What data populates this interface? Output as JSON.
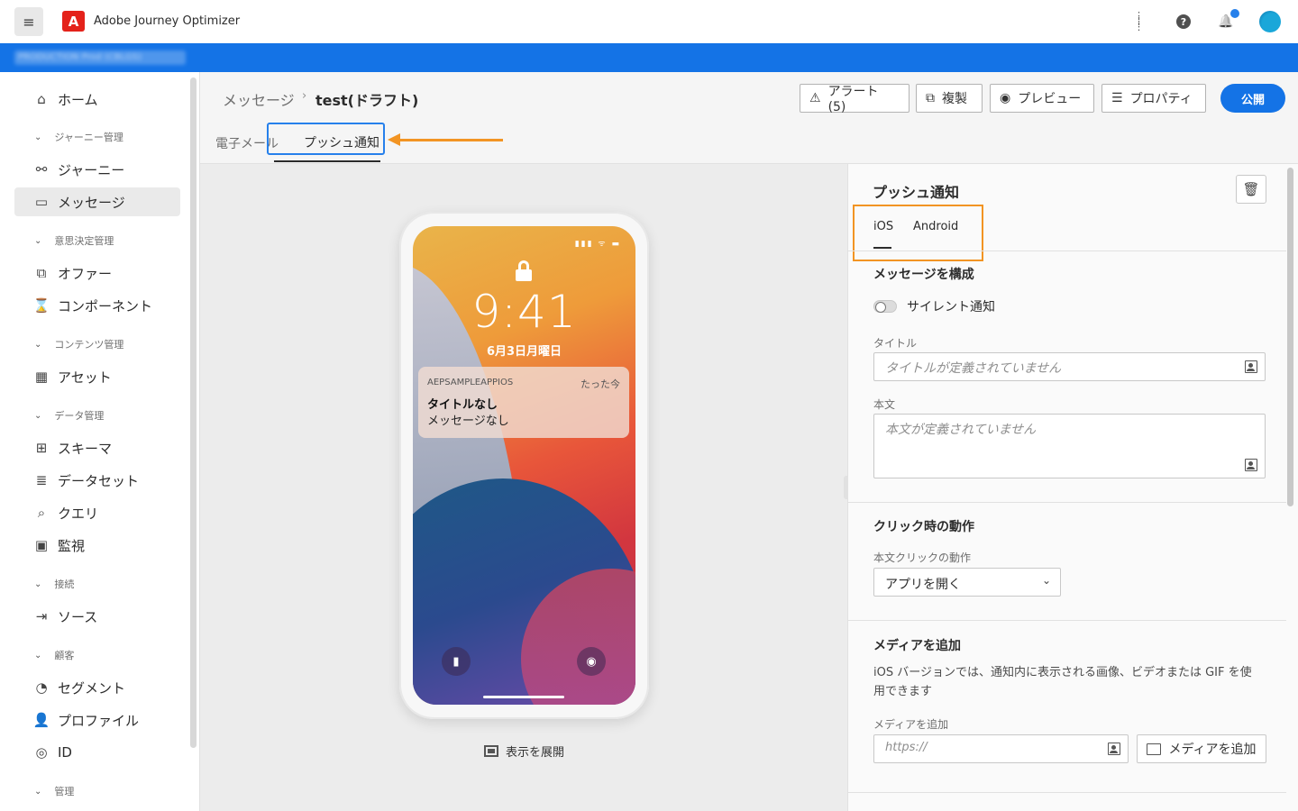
{
  "app": {
    "title": "Adobe Journey Optimizer",
    "logo_letter": "A",
    "org_switcher": "PRODUCTION  Prod (CBLGS)",
    "colors": {
      "accent": "#1473e6",
      "highlight": "#f29423",
      "focus": "#2680eb"
    }
  },
  "topbar": {
    "menu_icon": "hamburger-icon",
    "icons": [
      "apps-grid-icon",
      "help-icon",
      "bell-icon"
    ],
    "glyphs": {
      "menu": "≡",
      "apps": "⋮⋮⋮",
      "help": "?",
      "bell": "🔔"
    }
  },
  "sidebar": {
    "items": [
      {
        "type": "item",
        "label": "ホーム",
        "icon": "⌂",
        "active": false
      },
      {
        "type": "section",
        "label": "ジャーニー管理"
      },
      {
        "type": "item",
        "label": "ジャーニー",
        "icon": "⚯",
        "active": false
      },
      {
        "type": "item",
        "label": "メッセージ",
        "icon": "▭",
        "active": true
      },
      {
        "type": "section",
        "label": "意思決定管理"
      },
      {
        "type": "item",
        "label": "オファー",
        "icon": "⧉",
        "active": false
      },
      {
        "type": "item",
        "label": "コンポーネント",
        "icon": "⌛",
        "active": false
      },
      {
        "type": "section",
        "label": "コンテンツ管理"
      },
      {
        "type": "item",
        "label": "アセット",
        "icon": "▦",
        "active": false
      },
      {
        "type": "section",
        "label": "データ管理"
      },
      {
        "type": "item",
        "label": "スキーマ",
        "icon": "⊞",
        "active": false
      },
      {
        "type": "item",
        "label": "データセット",
        "icon": "≣",
        "active": false
      },
      {
        "type": "item",
        "label": "クエリ",
        "icon": "⌕",
        "active": false
      },
      {
        "type": "item",
        "label": "監視",
        "icon": "▣",
        "active": false
      },
      {
        "type": "section",
        "label": "接続"
      },
      {
        "type": "item",
        "label": "ソース",
        "icon": "⇥",
        "active": false
      },
      {
        "type": "section",
        "label": "顧客"
      },
      {
        "type": "item",
        "label": "セグメント",
        "icon": "◔",
        "active": false
      },
      {
        "type": "item",
        "label": "プロファイル",
        "icon": "👤",
        "active": false
      },
      {
        "type": "item",
        "label": "ID",
        "icon": "◎",
        "active": false
      },
      {
        "type": "section",
        "label": "管理"
      }
    ],
    "section_chevron": "⌄"
  },
  "header": {
    "breadcrumb_parent": "メッセージ",
    "breadcrumb_sep": "›",
    "breadcrumb_current": "test(ドラフト)",
    "buttons": {
      "alerts": "アラート (5)",
      "alerts_icon": "⚠",
      "duplicate": "複製",
      "duplicate_icon": "⧉",
      "preview": "プレビュー",
      "preview_icon": "◉",
      "properties": "プロパティ",
      "properties_icon": "☰",
      "publish": "公開"
    },
    "channel_tabs": {
      "email": "電子メール",
      "push": "プッシュ通知"
    }
  },
  "preview": {
    "status_bar": "▮▮▮ ᯤ ▬",
    "time": "9:41",
    "date": "6月3日月曜日",
    "notification": {
      "app_name": "AEPSAMPLEAPPIOS",
      "time": "たった今",
      "title": "タイトルなし",
      "body": "メッセージなし"
    },
    "flashlight_icon": "▮",
    "camera_icon": "◉",
    "expand_label": "表示を展開"
  },
  "panel": {
    "title": "プッシュ通知",
    "trash_icon": "🗑",
    "os_tabs": {
      "ios": "iOS",
      "android": "Android",
      "selected": "ios"
    },
    "compose_title": "メッセージを構成",
    "silent_label": "サイレント通知",
    "silent_on": false,
    "title_label": "タイトル",
    "title_placeholder": "タイトルが定義されていません",
    "body_label": "本文",
    "body_placeholder": "本文が定義されていません",
    "click_title": "クリック時の動作",
    "click_label": "本文クリックの動作",
    "click_value": "アプリを開く",
    "click_chevron": "⌄",
    "media_title": "メディアを追加",
    "media_desc": "iOS バージョンでは、通知内に表示される画像、ビデオまたは GIF を使用できます",
    "media_label": "メディアを追加",
    "media_placeholder": "https://",
    "media_button": "メディアを追加"
  }
}
